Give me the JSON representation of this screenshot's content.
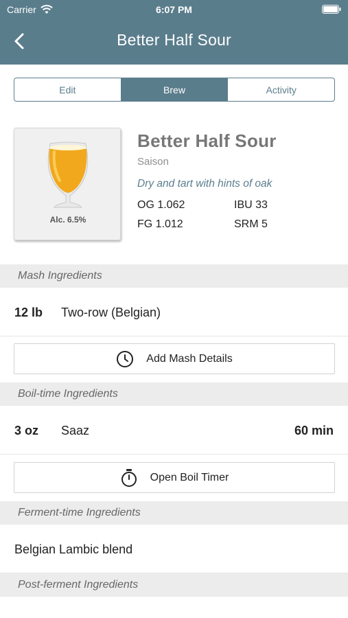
{
  "status": {
    "carrier": "Carrier",
    "time": "6:07 PM"
  },
  "nav": {
    "title": "Better Half Sour"
  },
  "tabs": [
    {
      "label": "Edit",
      "active": false
    },
    {
      "label": "Brew",
      "active": true
    },
    {
      "label": "Activity",
      "active": false
    }
  ],
  "beer": {
    "abv": "Alc. 6.5%",
    "name": "Better Half Sour",
    "style": "Saison",
    "description": "Dry and tart with hints of oak",
    "og": "OG 1.062",
    "ibu": "IBU 33",
    "fg": "FG 1.012",
    "srm": "SRM 5"
  },
  "sections": {
    "mash": "Mash Ingredients",
    "boil": "Boil-time Ingredients",
    "ferment": "Ferment-time Ingredients",
    "post": "Post-ferment Ingredients"
  },
  "mash_items": [
    {
      "qty": "12 lb",
      "name": "Two-row (Belgian)"
    }
  ],
  "mash_button": "Add Mash Details",
  "boil_items": [
    {
      "qty": "3 oz",
      "name": "Saaz",
      "time": "60 min"
    }
  ],
  "boil_button": "Open Boil Timer",
  "ferment_items": [
    {
      "name": "Belgian Lambic blend"
    }
  ],
  "colors": {
    "accent": "#5a7d8c",
    "beer": "#f2a81c"
  },
  "icons": {
    "back": "chevron-left-icon",
    "wifi": "wifi-icon",
    "battery": "battery-icon",
    "mash": "clock-icon",
    "boil": "stopwatch-icon",
    "glass": "beer-glass-icon"
  }
}
